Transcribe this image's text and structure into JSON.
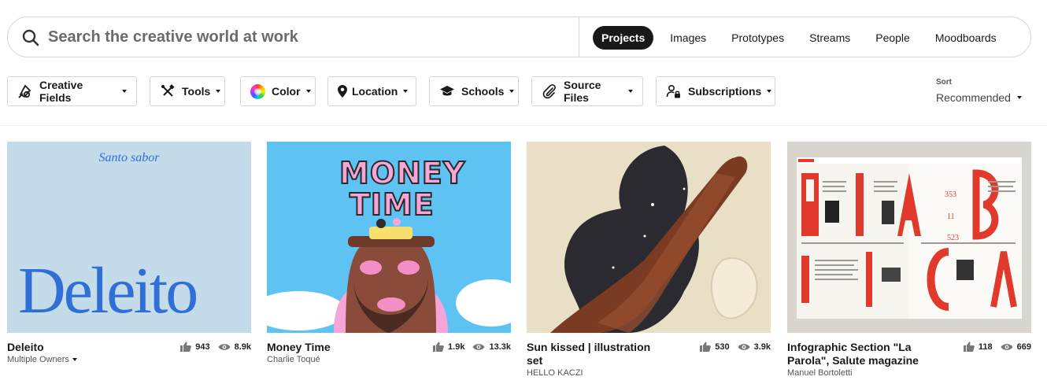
{
  "search": {
    "placeholder": "Search the creative world at work"
  },
  "tabs": [
    {
      "label": "Projects",
      "active": true
    },
    {
      "label": "Images"
    },
    {
      "label": "Prototypes"
    },
    {
      "label": "Streams"
    },
    {
      "label": "People"
    },
    {
      "label": "Moodboards"
    }
  ],
  "filters": {
    "creative_fields": "Creative Fields",
    "tools": "Tools",
    "color": "Color",
    "location": "Location",
    "schools": "Schools",
    "source_files": "Source Files",
    "subscriptions": "Subscriptions"
  },
  "sort": {
    "label": "Sort",
    "value": "Recommended"
  },
  "cards": [
    {
      "title": "Deleito",
      "owner": "Multiple Owners",
      "likes": "943",
      "views": "8.9k",
      "art_top": "Santo sabor",
      "art_main": "Deleito"
    },
    {
      "title": "Money Time",
      "owner": "Charlie Toqué",
      "likes": "1.9k",
      "views": "13.3k",
      "art_line1": "MONEY",
      "art_line2": "TIME"
    },
    {
      "title": "Sun kissed | illustration set",
      "owner": "HELLO KACZI",
      "likes": "530",
      "views": "3.9k"
    },
    {
      "title": "Infographic Section \"La Parola\", Salute magazine",
      "owner": "Manuel Bortoletti",
      "likes": "118",
      "views": "669"
    }
  ],
  "colors": {
    "accent_dark": "#191919",
    "deleito_bg": "#c4dcea",
    "deleito_blue": "#2f6fd6",
    "money_bg": "#5ec3f3",
    "money_pink": "#f5a6d8",
    "sun_bg": "#e9dfc6",
    "infographic_red": "#e13a2c"
  }
}
